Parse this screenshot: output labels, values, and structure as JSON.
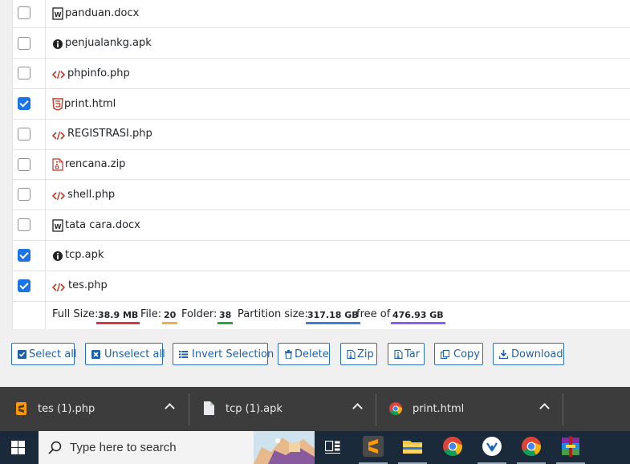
{
  "files": [
    {
      "name": "panduan.docx",
      "icon": "word-file-icon",
      "checked": false
    },
    {
      "name": "penjualankg.apk",
      "icon": "info-circle-icon",
      "checked": false
    },
    {
      "name": "phpinfo.php",
      "icon": "code-icon",
      "checked": false
    },
    {
      "name": "print.html",
      "icon": "html5-icon",
      "checked": true
    },
    {
      "name": "REGISTRASI.php",
      "icon": "code-icon",
      "checked": false
    },
    {
      "name": "rencana.zip",
      "icon": "archive-file-icon",
      "checked": false
    },
    {
      "name": "shell.php",
      "icon": "code-icon",
      "checked": false
    },
    {
      "name": "tata cara.docx",
      "icon": "word-file-icon",
      "checked": false
    },
    {
      "name": "tcp.apk",
      "icon": "info-circle-icon",
      "checked": true
    },
    {
      "name": "tes.php",
      "icon": "code-icon",
      "checked": true
    }
  ],
  "summary": {
    "full_size_label": "Full Size:",
    "full_size_value": "38.9 MB",
    "file_label": "File:",
    "file_value": "20",
    "folder_label": "Folder:",
    "folder_value": "38",
    "partition_label": "Partition size:",
    "partition_value": "317.18 GB",
    "free_label": "free of",
    "free_value": "476.93 GB"
  },
  "actions": {
    "select_all": "Select all",
    "unselect_all": "Unselect all",
    "invert_selection": "Invert Selection",
    "delete": "Delete",
    "zip": "Zip",
    "tar": "Tar",
    "copy": "Copy",
    "download": "Download"
  },
  "downloads": [
    {
      "name": "tes (1).php",
      "icon": "sublime-file-icon"
    },
    {
      "name": "tcp (1).apk",
      "icon": "file-icon"
    },
    {
      "name": "print.html",
      "icon": "chrome-icon"
    }
  ],
  "taskbar": {
    "search_placeholder": "Type here to search"
  },
  "colors": {
    "accent": "#2a6fb5",
    "checkbox": "#1a73e8",
    "full_size_underline": "#dc3545",
    "file_underline": "#f0ad4e",
    "folder_underline": "#28a745",
    "partition_underline": "#3b7ddd",
    "free_underline": "#8b5cf6",
    "code_icon": "#c0392b"
  }
}
